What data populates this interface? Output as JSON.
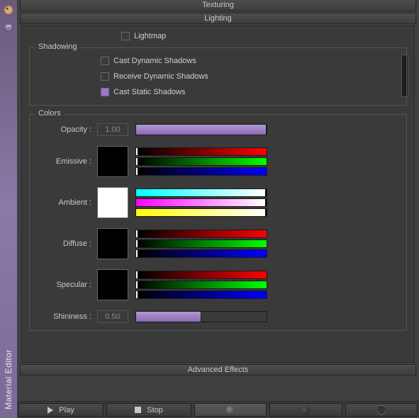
{
  "app": {
    "vertical_title": "Material Editor"
  },
  "sections": {
    "texturing": "Texturing",
    "lighting": "Lighting",
    "advanced": "Advanced Effects"
  },
  "lighting": {
    "lightmap_label": "Lightmap",
    "lightmap_checked": false,
    "shadowing": {
      "group_label": "Shadowing",
      "cast_dynamic": {
        "label": "Cast Dynamic Shadows",
        "checked": false
      },
      "receive_dynamic": {
        "label": "Receive Dynamic Shadows",
        "checked": false
      },
      "cast_static": {
        "label": "Cast Static Shadows",
        "checked": true
      }
    },
    "colors": {
      "group_label": "Colors",
      "opacity": {
        "label": "Opacity :",
        "value": "1.00",
        "fill_pct": 100
      },
      "emissive": {
        "label": "Emissive :",
        "swatch": "#000000",
        "r": 0,
        "g": 0,
        "b": 0
      },
      "ambient": {
        "label": "Ambient :",
        "swatch": "#ffffff",
        "r": 255,
        "g": 255,
        "b": 255
      },
      "diffuse": {
        "label": "Diffuse :",
        "swatch": "#000000",
        "r": 0,
        "g": 0,
        "b": 0
      },
      "specular": {
        "label": "Specular :",
        "swatch": "#000000",
        "r": 0,
        "g": 0,
        "b": 0
      },
      "shininess": {
        "label": "Shininess :",
        "value": "0.50",
        "fill_pct": 50
      }
    }
  },
  "controls": {
    "play": "Play",
    "stop": "Stop"
  }
}
